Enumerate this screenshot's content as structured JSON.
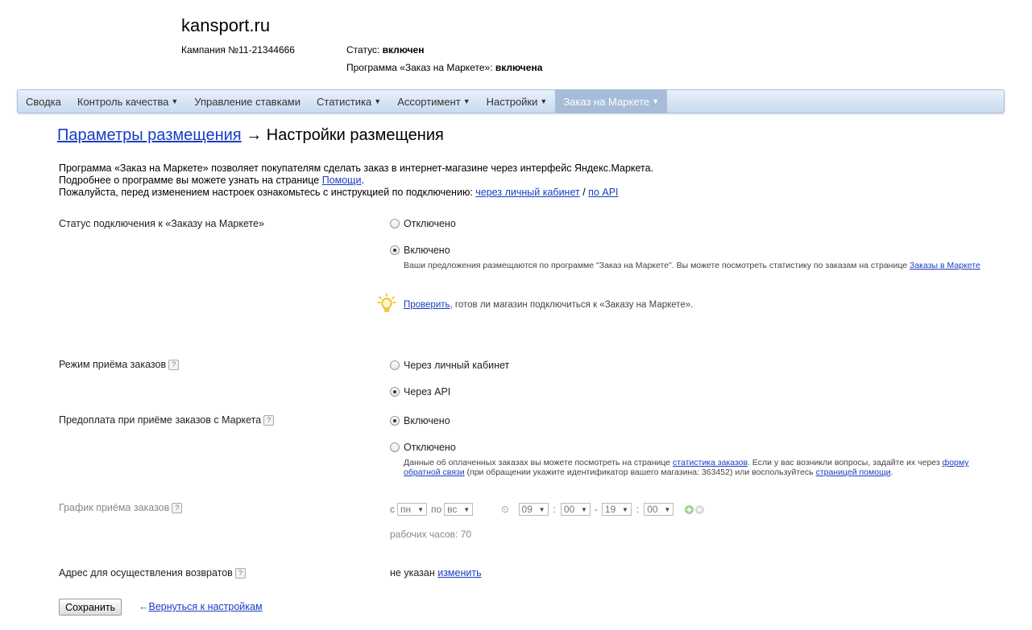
{
  "header": {
    "shop_name": "kansport.ru",
    "campaign": "Кампания №11-21344666",
    "status_label": "Статус:",
    "status_value": "включен",
    "program_label": "Программа «Заказ на Маркете»:",
    "program_value": "включена"
  },
  "nav": {
    "items": [
      {
        "label": "Сводка",
        "caret": ""
      },
      {
        "label": "Контроль качества",
        "caret": "▼"
      },
      {
        "label": "Управление ставками",
        "caret": ""
      },
      {
        "label": "Статистика",
        "caret": "▼"
      },
      {
        "label": "Ассортимент",
        "caret": "▼"
      },
      {
        "label": "Настройки",
        "caret": "▼"
      },
      {
        "label": "Заказ на Маркете",
        "caret": "▼"
      }
    ]
  },
  "breadcrumb": {
    "parent": "Параметры размещения",
    "arrow": "→",
    "current": "Настройки размещения"
  },
  "intro": {
    "line1": "Программа «Заказ на Маркете» позволяет покупателям сделать заказ в интернет-магазине через интерфейс Яндекс.Маркета.",
    "line2_prefix": "Подробнее о программе вы можете узнать на странице",
    "line2_link": "Помощи",
    "line2_suffix": ".",
    "line3_prefix": "Пожалуйста, перед изменением настроек ознакомьтесь с инструкцией по подключению:",
    "line3_link1": "через личный кабинет",
    "line3_sep": "/",
    "line3_link2": "по API"
  },
  "connection": {
    "label": "Статус подключения к «Заказу на Маркете»",
    "option_off": "Отключено",
    "option_on": "Включено",
    "hint_prefix": "Ваши предложения размещаются по программе \"Заказ на Маркете\". Вы можете посмотреть статистику по заказам на странице",
    "hint_link": "Заказы в Маркете",
    "check_link": "Проверить",
    "check_suffix": ", готов ли магазин подключиться к «Заказу на Маркете»."
  },
  "order_mode": {
    "label": "Режим приёма заказов",
    "help": "?",
    "option_cabinet": "Через личный кабинет",
    "option_api": "Через API"
  },
  "prepayment": {
    "label": "Предоплата при приёме заказов с Маркета",
    "help": "?",
    "option_on": "Включено",
    "option_off": "Отключено",
    "hint_p1": "Данные об оплаченных заказах вы можете посмотреть на странице",
    "hint_link1": "статистика заказов",
    "hint_p2": ". Если у вас возникли вопросы, задайте их через",
    "hint_link2": "форму обратной связи",
    "hint_p3": "(при обращении укажите идентификатор вашего магазина: 363452) или воспользуйтесь",
    "hint_link3": "страницей помощи",
    "hint_p4": "."
  },
  "schedule": {
    "label": "График приёма заказов",
    "help": "?",
    "from_label": "с",
    "from_day": "пн",
    "to_label": "по",
    "to_day": "вс",
    "clock_icon": "⏲",
    "h1": "09",
    "m1": "00",
    "dash": "-",
    "h2": "19",
    "m2": "00",
    "colon": ":",
    "work_hours": "рабочих часов: 70"
  },
  "return_address": {
    "label": "Адрес для осуществления возвратов",
    "help": "?",
    "value": "не указан",
    "change_link": "изменить"
  },
  "footer": {
    "save": "Сохранить",
    "back_arrow": "←",
    "back_link": "Вернуться к настройкам"
  },
  "colors": {
    "link": "#1a3dc1",
    "nav_active": "#a6bcd8",
    "hint_icon": "#f0b400"
  }
}
